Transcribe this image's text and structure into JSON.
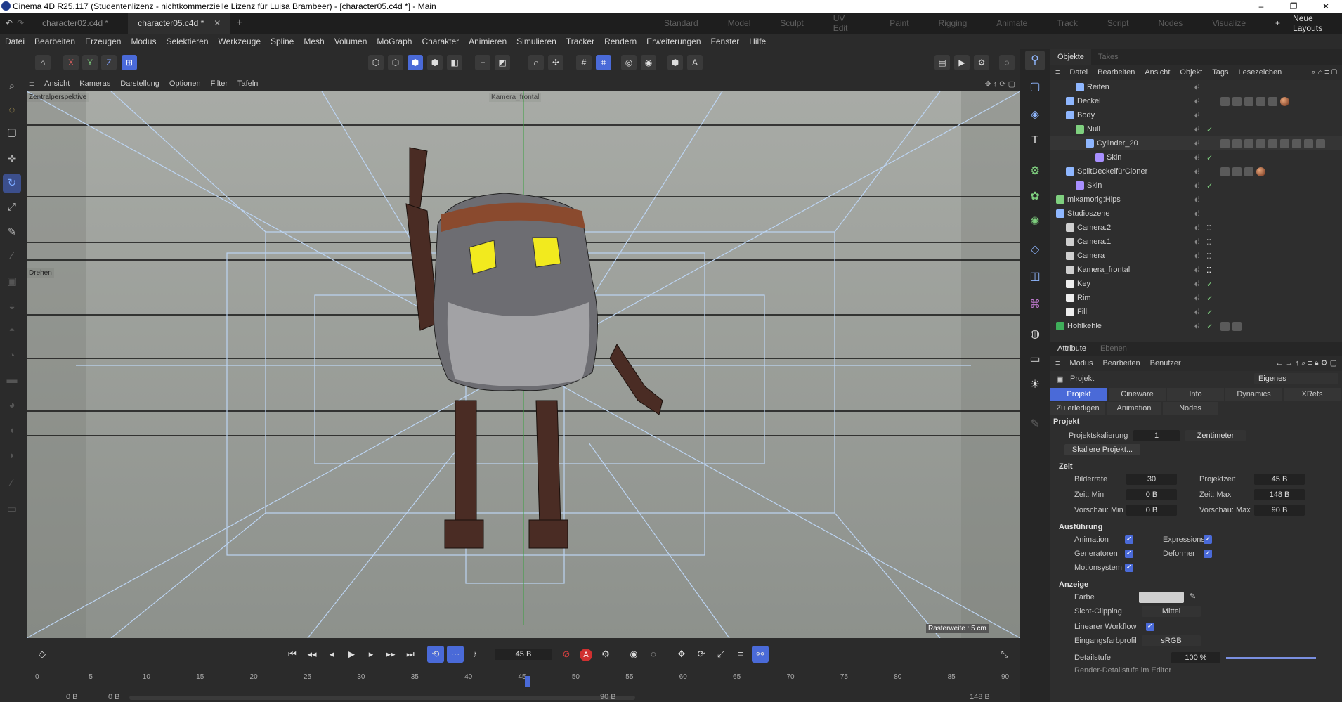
{
  "titlebar": {
    "title": "Cinema 4D R25.117 (Studentenlizenz - nichtkommerzielle Lizenz für Luisa Brambeer) - [character05.c4d *] - Main"
  },
  "tabs": {
    "tab1": "character02.c4d *",
    "tab2": "character05.c4d *",
    "add": "+"
  },
  "layouts": {
    "items": [
      "Standard",
      "Model",
      "Sculpt",
      "UV Edit",
      "Paint",
      "Rigging",
      "Animate",
      "Track",
      "Script",
      "Nodes",
      "Visualize"
    ],
    "neue": "Neue Layouts"
  },
  "menu": [
    "Datei",
    "Bearbeiten",
    "Erzeugen",
    "Modus",
    "Selektieren",
    "Werkzeuge",
    "Spline",
    "Mesh",
    "Volumen",
    "MoGraph",
    "Charakter",
    "Animieren",
    "Simulieren",
    "Tracker",
    "Rendern",
    "Erweiterungen",
    "Fenster",
    "Hilfe"
  ],
  "viewport": {
    "menu": [
      "Ansicht",
      "Kameras",
      "Darstellung",
      "Optionen",
      "Filter",
      "Tafeln"
    ],
    "persp": "Zentralperspektive",
    "camera": "Kamera_frontal",
    "drehen": "Drehen",
    "raster": "Rasterweite : 5 cm"
  },
  "objects": {
    "tabs": [
      "Objekte",
      "Takes"
    ],
    "menu": [
      "Datei",
      "Bearbeiten",
      "Ansicht",
      "Objekt",
      "Tags",
      "Lesezeichen"
    ],
    "rows": [
      "Reifen",
      "Deckel",
      "Body",
      "Null",
      "Cylinder_20",
      "Skin",
      "SplitDeckelfürCloner",
      "Skin",
      "mixamorig:Hips",
      "Studioszene",
      "Camera.2",
      "Camera.1",
      "Camera",
      "Kamera_frontal",
      "Key",
      "Rim",
      "Fill",
      "Hohlkehle"
    ]
  },
  "attributes": {
    "tabs": [
      "Attribute",
      "Ebenen"
    ],
    "menu": [
      "Modus",
      "Bearbeiten",
      "Benutzer"
    ],
    "projekt": "Projekt",
    "eigenes": "Eigenes",
    "tabrow1": [
      "Projekt",
      "Cineware",
      "Info",
      "Dynamics",
      "XRefs"
    ],
    "tabrow2": [
      "Zu erledigen",
      "Animation",
      "Nodes"
    ],
    "section_projekt": "Projekt",
    "skal_label": "Projektskalierung",
    "skal_value": "1",
    "skal_unit": "Zentimeter",
    "skal_btn": "Skaliere Projekt...",
    "section_zeit": "Zeit",
    "bilderrate_l": "Bilderrate",
    "bilderrate_v": "30",
    "projektzeit_l": "Projektzeit",
    "projektzeit_v": "45 B",
    "zeitmin_l": "Zeit: Min",
    "zeitmin_v": "0 B",
    "zeitmax_l": "Zeit: Max",
    "zeitmax_v": "148 B",
    "vormin_l": "Vorschau: Min",
    "vormin_v": "0 B",
    "vormax_l": "Vorschau: Max",
    "vormax_v": "90 B",
    "section_ausf": "Ausführung",
    "animation": "Animation",
    "expressions": "Expressions",
    "generatoren": "Generatoren",
    "deformer": "Deformer",
    "motionsystem": "Motionsystem",
    "section_anzeige": "Anzeige",
    "farbe": "Farbe",
    "sicht": "Sicht-Clipping",
    "sicht_v": "Mittel",
    "linear": "Linearer Workflow",
    "eingang": "Eingangsfarbprofil",
    "eingang_v": "sRGB",
    "detail": "Detailstufe",
    "detail_v": "100 %",
    "render": "Render-Detailstufe im Editor"
  },
  "timeline": {
    "frame": "45 B",
    "start": "0 B",
    "start2": "0 B",
    "end": "90 B",
    "end2": "148 B",
    "ticks": [
      "0",
      "5",
      "10",
      "15",
      "20",
      "25",
      "30",
      "35",
      "40",
      "45",
      "50",
      "55",
      "60",
      "65",
      "70",
      "75",
      "80",
      "85",
      "90"
    ]
  },
  "colors": {
    "accent": "#4a6ad8",
    "viewport": "#9a9d98"
  }
}
